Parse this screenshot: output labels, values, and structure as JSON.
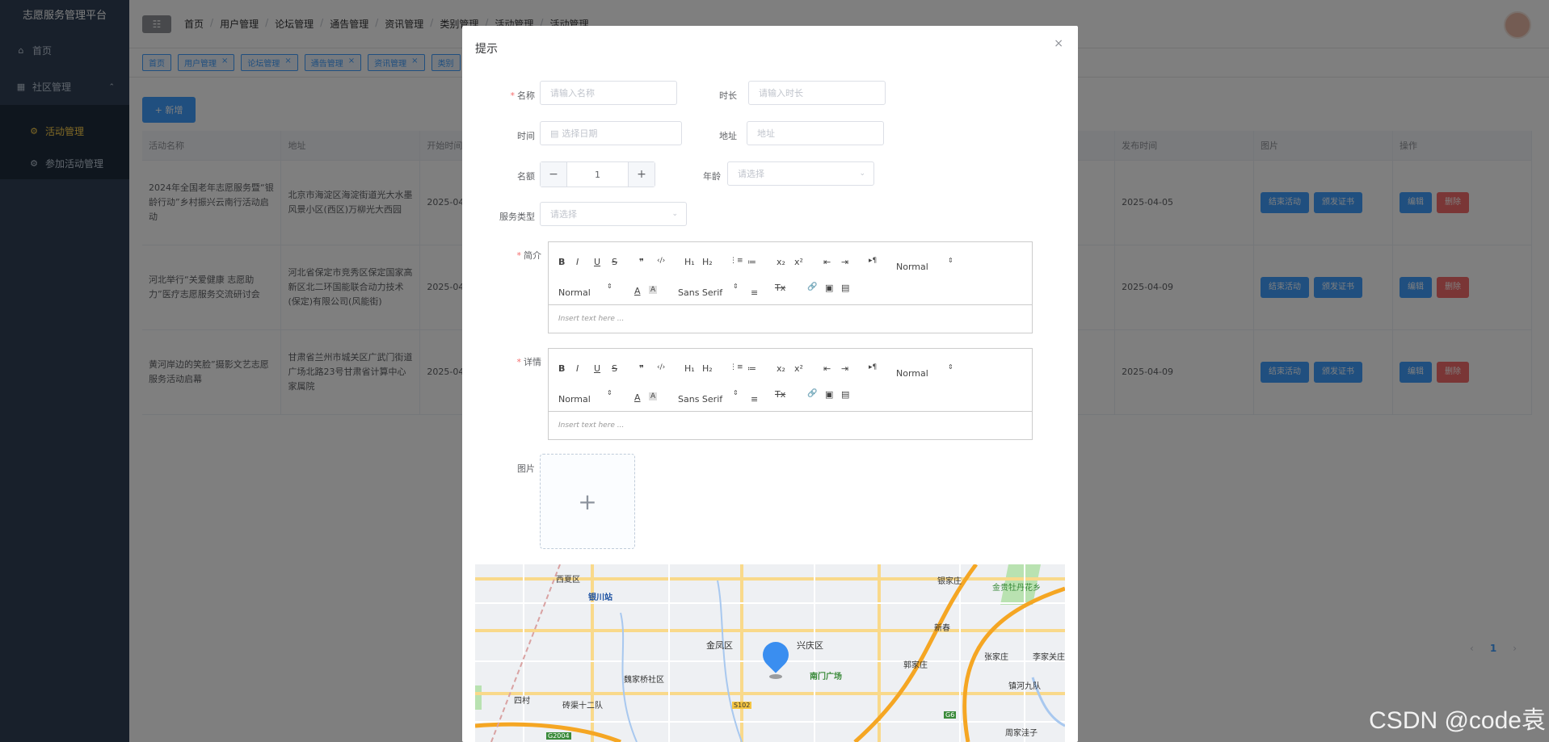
{
  "app": {
    "title": "志愿服务管理平台"
  },
  "sidebar": {
    "items": [
      {
        "label": "首页"
      },
      {
        "label": "社区管理"
      },
      {
        "label": "活动管理"
      },
      {
        "label": "参加活动管理"
      }
    ]
  },
  "breadcrumb": [
    "首页",
    "用户管理",
    "论坛管理",
    "通告管理",
    "资讯管理",
    "类别管理",
    "活动管理",
    "活动管理"
  ],
  "tags": [
    "首页",
    "用户管理",
    "论坛管理",
    "通告管理",
    "资讯管理",
    "类别"
  ],
  "toolbar": {
    "add_label": "+ 新增"
  },
  "table": {
    "headers": [
      "活动名称",
      "地址",
      "开始时间",
      "发布时间",
      "图片",
      "操作"
    ],
    "rows": [
      {
        "name": "2024年全国老年志愿服务暨“银龄行动”乡村振兴云南行活动启动",
        "address": "北京市海淀区海淀街道光大水墨风景小区(西区)万柳光大西园",
        "start": "2025-04",
        "published": "2025-04-05"
      },
      {
        "name": "河北举行“关爱健康 志愿助力”医疗志愿服务交流研讨会",
        "address": "河北省保定市竞秀区保定国家高新区北二环国能联合动力技术(保定)有限公司(风能街)",
        "start": "2025-04",
        "published": "2025-04-09"
      },
      {
        "name": "黄河岸边的笑脸”摄影文艺志愿服务活动启幕",
        "address": "甘肃省兰州市城关区广武门街道广场北路23号甘肃省计算中心家属院",
        "start": "2025-04",
        "published": "2025-04-09"
      }
    ],
    "row_buttons": {
      "end": "结束活动",
      "cert": "颁发证书",
      "edit": "编辑",
      "delete": "删除"
    }
  },
  "pager": {
    "prev": "‹",
    "page": "1",
    "next": "›"
  },
  "dialog": {
    "title": "提示",
    "close": "×",
    "fields": {
      "name": {
        "label": "名称",
        "placeholder": "请输入名称"
      },
      "duration": {
        "label": "时长",
        "placeholder": "请输入时长"
      },
      "time": {
        "label": "时间",
        "placeholder": "选择日期"
      },
      "address": {
        "label": "地址",
        "placeholder": "地址"
      },
      "quota": {
        "label": "名额",
        "value": "1",
        "minus": "−",
        "plus": "+"
      },
      "age": {
        "label": "年龄",
        "placeholder": "请选择"
      },
      "service_type": {
        "label": "服务类型",
        "placeholder": "请选择"
      },
      "intro": {
        "label": "简介"
      },
      "detail": {
        "label": "详情"
      },
      "image": {
        "label": "图片",
        "plus": "+"
      }
    },
    "editor": {
      "bold": "B",
      "italic": "I",
      "underline": "U",
      "strike": "S",
      "quote": "❞",
      "code": "‹/›",
      "h1": "H₁",
      "h2": "H₂",
      "ol": "⋮≡",
      "ul": "≔",
      "sub": "x₂",
      "sup": "x²",
      "outdent": "⇤",
      "indent": "⇥",
      "dir": "▸¶",
      "size": "Normal",
      "header": "Normal",
      "font": "Sans Serif",
      "color": "A",
      "bg": "A",
      "align": "≡",
      "clean": "Tx",
      "link": "🔗",
      "img": "▣",
      "video": "▤",
      "placeholder": "Insert text here ..."
    },
    "map": {
      "labels": [
        "西夏区",
        "银川站",
        "金凤区",
        "兴庆区",
        "南门广场",
        "魏家桥社区",
        "四村",
        "砖渠十二队",
        "郭家庄",
        "新春",
        "张家庄",
        "李家关庄",
        "镇河九队",
        "周家洼子",
        "金贵牡丹花乡",
        "银家庄",
        "S102",
        "G6",
        "G2004"
      ]
    }
  },
  "watermark": "CSDN @code袁"
}
